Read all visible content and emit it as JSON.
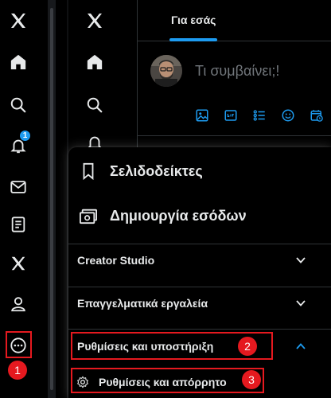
{
  "left_nav": {
    "items": [
      "x-logo-icon",
      "home-icon",
      "search-icon",
      "bell-icon",
      "mail-icon",
      "lists-icon",
      "x-premium-icon",
      "profile-icon",
      "more-icon"
    ],
    "notification_count": "1",
    "step1_label": "1"
  },
  "feed": {
    "tab_for_you": "Για εσάς",
    "compose_placeholder": "Τι συμβαίνει;!",
    "accent": "#1d9bf0"
  },
  "menu": {
    "bookmarks": "Σελιδοδείκτες",
    "monetization": "Δημιουργία εσόδων",
    "creator_studio": "Creator Studio",
    "professional_tools": "Επαγγελματικά εργαλεία",
    "settings_support": "Ρυθμίσεις και υποστήριξη",
    "settings_privacy": "Ρυθμίσεις και απόρρητο",
    "step2_label": "2",
    "step3_label": "3"
  },
  "colors": {
    "background": "#000000",
    "text": "#e7e9ea",
    "muted": "#71767b",
    "annotation_red": "#e5191f"
  }
}
